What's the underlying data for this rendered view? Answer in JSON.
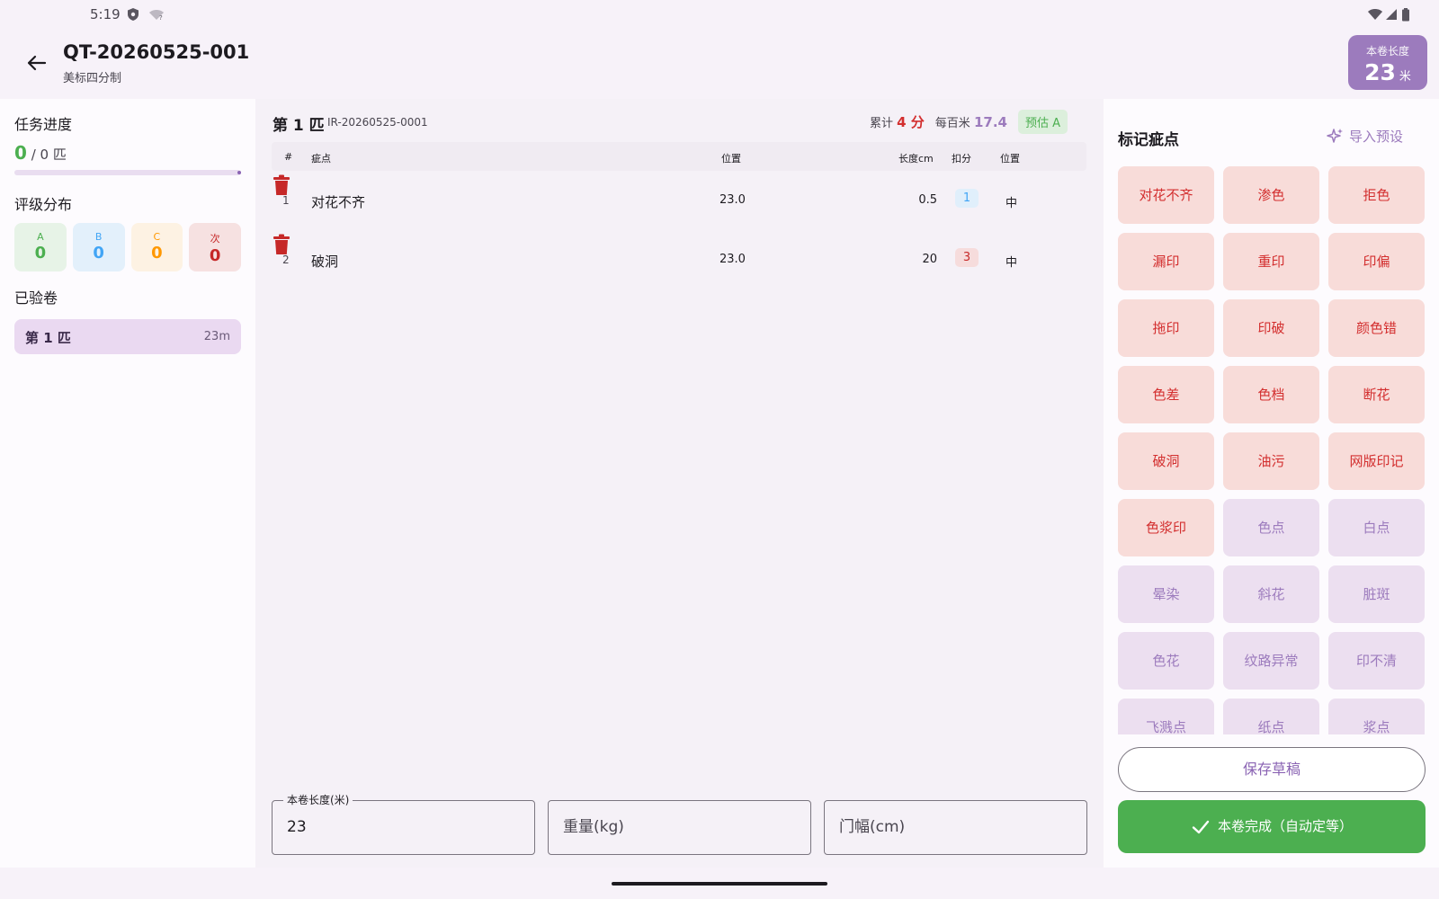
{
  "status_bar": {
    "time": "5:19"
  },
  "header": {
    "title": "QT-20260525-001",
    "subtitle": "美标四分制",
    "length_badge": {
      "label": "本卷长度",
      "value": "23",
      "unit": "米"
    }
  },
  "left": {
    "progress_title": "任务进度",
    "progress_done": "0",
    "progress_total": " / 0 匹",
    "grade_title": "评级分布",
    "grades": [
      {
        "grade": "A",
        "count": "0"
      },
      {
        "grade": "B",
        "count": "0"
      },
      {
        "grade": "C",
        "count": "0"
      },
      {
        "grade": "次",
        "count": "0"
      }
    ],
    "rolls_title": "已验卷",
    "rolls": [
      {
        "name": "第 1 匹",
        "length": "23m"
      }
    ]
  },
  "center": {
    "roll_title": "第 1 匹",
    "roll_id": "IR-20260525-0001",
    "total_label": "累计",
    "total_value": "4 分",
    "per_label": "每百米",
    "per_value": "17.4",
    "estimate": "预估 A",
    "columns": [
      "#",
      "疵点",
      "位置",
      "长度cm",
      "扣分",
      "位置"
    ],
    "rows": [
      {
        "num": "1",
        "defect": "对花不齐",
        "position": "23.0",
        "length_cm": "0.5",
        "score": "1",
        "place": "中"
      },
      {
        "num": "2",
        "defect": "破洞",
        "position": "23.0",
        "length_cm": "20",
        "score": "3",
        "place": "中"
      }
    ],
    "fields": {
      "length_label": "本卷长度(米)",
      "length_value": "23",
      "weight_placeholder": "重量(kg)",
      "width_placeholder": "门幅(cm)"
    }
  },
  "right": {
    "title": "标记疵点",
    "import_label": "导入预设",
    "chips": [
      {
        "label": "对花不齐",
        "style": "red"
      },
      {
        "label": "渗色",
        "style": "red"
      },
      {
        "label": "拒色",
        "style": "red"
      },
      {
        "label": "漏印",
        "style": "red"
      },
      {
        "label": "重印",
        "style": "red"
      },
      {
        "label": "印偏",
        "style": "red"
      },
      {
        "label": "拖印",
        "style": "red"
      },
      {
        "label": "印破",
        "style": "red"
      },
      {
        "label": "颜色错",
        "style": "red"
      },
      {
        "label": "色差",
        "style": "red"
      },
      {
        "label": "色档",
        "style": "red"
      },
      {
        "label": "断花",
        "style": "red"
      },
      {
        "label": "破洞",
        "style": "red"
      },
      {
        "label": "油污",
        "style": "red"
      },
      {
        "label": "网版印记",
        "style": "red"
      },
      {
        "label": "色浆印",
        "style": "red"
      },
      {
        "label": "色点",
        "style": "purple"
      },
      {
        "label": "白点",
        "style": "purple"
      },
      {
        "label": "晕染",
        "style": "purple"
      },
      {
        "label": "斜花",
        "style": "purple"
      },
      {
        "label": "脏斑",
        "style": "purple"
      },
      {
        "label": "色花",
        "style": "purple"
      },
      {
        "label": "纹路异常",
        "style": "purple"
      },
      {
        "label": "印不清",
        "style": "purple"
      },
      {
        "label": "飞溅点",
        "style": "purple"
      },
      {
        "label": "纸点",
        "style": "purple"
      },
      {
        "label": "浆点",
        "style": "purple"
      }
    ],
    "save_label": "保存草稿",
    "done_label": "本卷完成（自动定等）"
  },
  "colors": {
    "accent": "#9c7bbd",
    "success": "#4caf50",
    "danger": "#d32f2f"
  }
}
